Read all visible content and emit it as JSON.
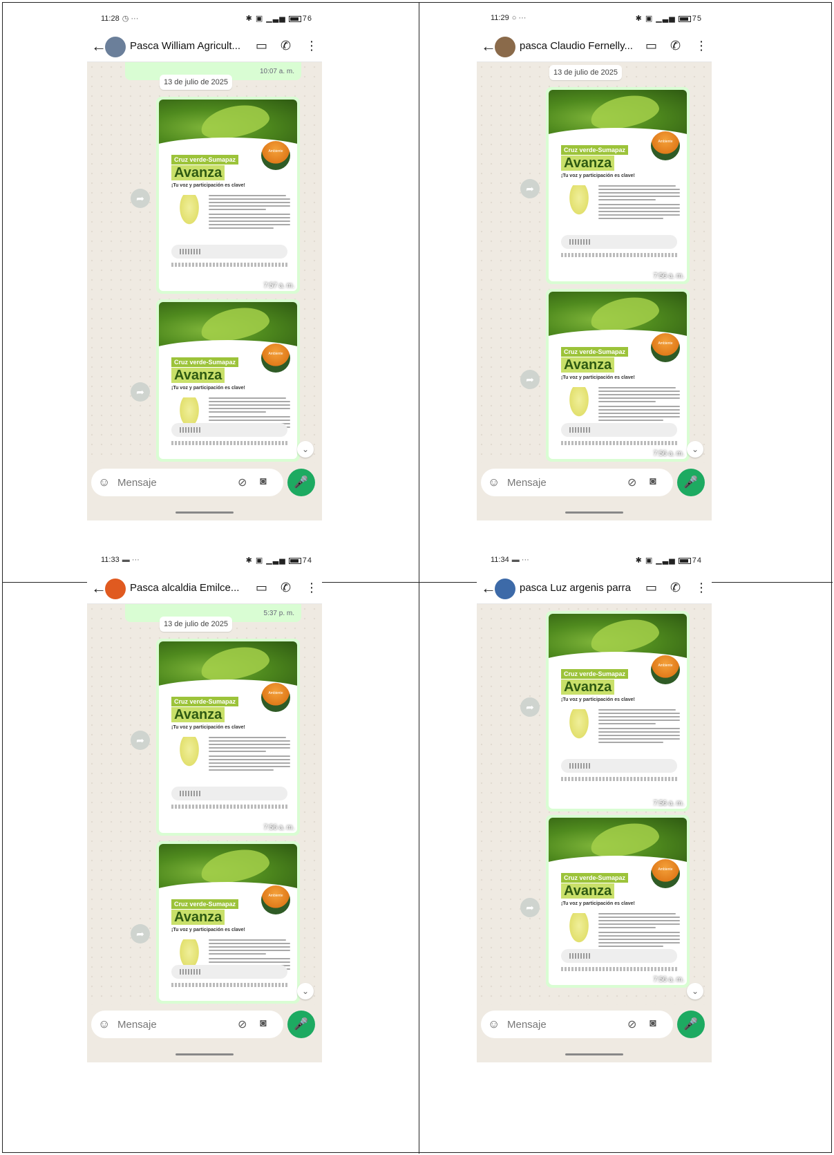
{
  "phones": [
    {
      "status_time": "11:28",
      "status_extra": "◷ ···",
      "battery": "76",
      "contact_name": "Pasca William Agricult...",
      "top_bubble_time": "10:07 a. m.",
      "date": "13 de julio de 2025",
      "bubble_times": [
        "7:57 a. m.",
        ""
      ],
      "input_placeholder": "Mensaje"
    },
    {
      "status_time": "11:29",
      "status_extra": "○ ···",
      "battery": "75",
      "contact_name": "pasca Claudio Fernelly...",
      "top_bubble_time": "",
      "date": "13 de julio de 2025",
      "bubble_times": [
        "7:56 a. m.",
        "7:56 a. m."
      ],
      "input_placeholder": "Mensaje"
    },
    {
      "status_time": "11:33",
      "status_extra": "▬ ···",
      "battery": "74",
      "contact_name": "Pasca alcaldia Emilce...",
      "top_bubble_time": "5:37 p. m.",
      "date": "13 de julio de 2025",
      "bubble_times": [
        "7:56 a. m.",
        ""
      ],
      "input_placeholder": "Mensaje"
    },
    {
      "status_time": "11:34",
      "status_extra": "▬ ···",
      "battery": "74",
      "contact_name": "pasca Luz argenis parra",
      "top_bubble_time": "",
      "date": "",
      "bubble_times": [
        "7:56 a. m.",
        "7:56 a. m."
      ],
      "input_placeholder": "Mensaje"
    }
  ],
  "poster": {
    "ribbon": "Cruz verde-Sumapaz",
    "title": "Avanza",
    "tagline": "¡Tu voz y participación es clave!",
    "badge_text": "Ambiente",
    "ministry_label": "Ambiente"
  },
  "icons": {
    "back": "←",
    "video": "▭",
    "call": "✆",
    "menu": "⋮",
    "forward": "➦",
    "emoji": "☺",
    "attach": "⊘",
    "camera": "◙",
    "mic": "🎤",
    "scroll": "⌄"
  },
  "colors": {
    "accent_green": "#1daa61",
    "bubble_green": "#d9fdd3",
    "poster_ribbon": "#9cc33a",
    "poster_title_bg": "#c9e06a"
  }
}
